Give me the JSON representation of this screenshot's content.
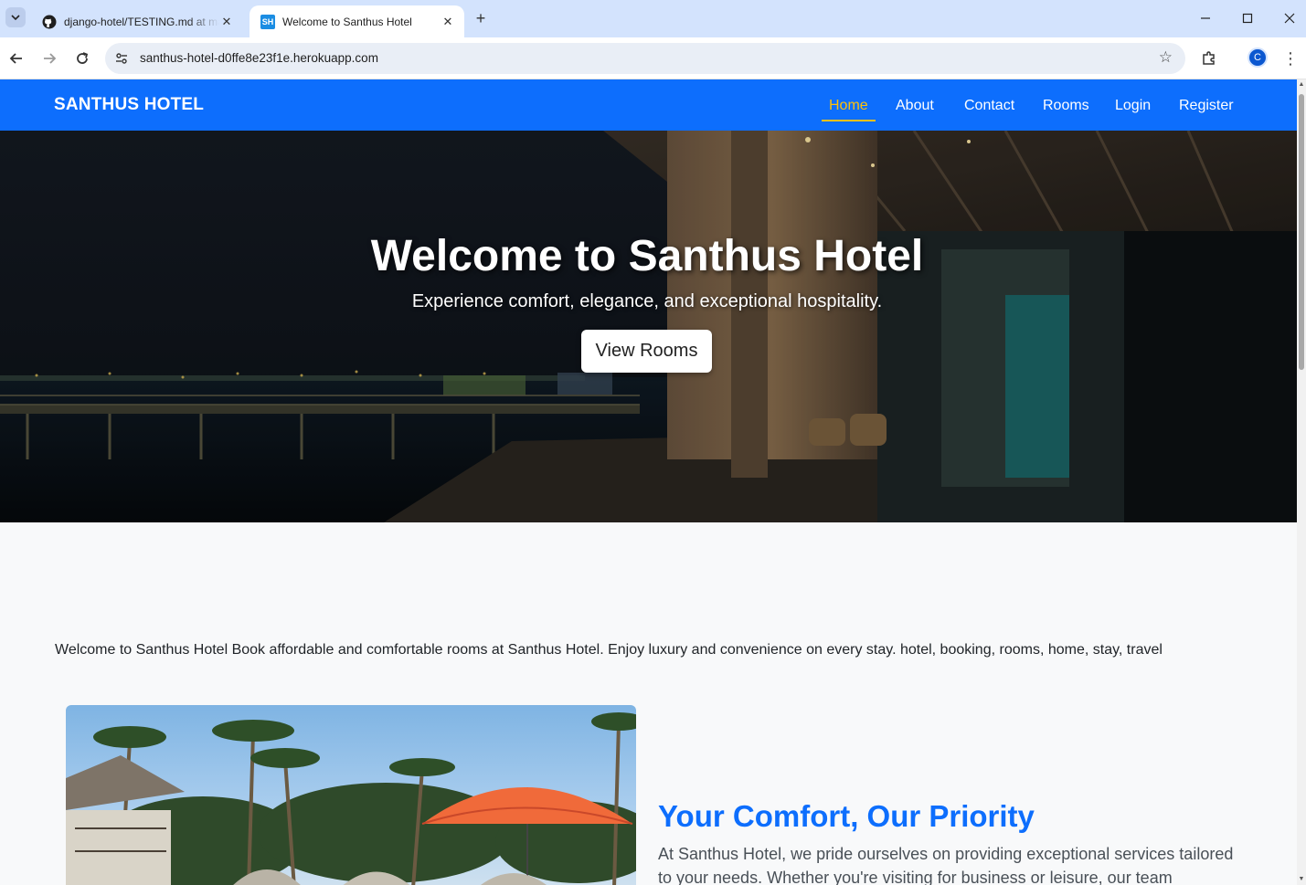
{
  "browser": {
    "tabs": [
      {
        "title": "django-hotel/TESTING.md at main",
        "active": false,
        "icon": "github-icon"
      },
      {
        "title": "Welcome to Santhus Hotel",
        "active": true,
        "icon": "SH"
      }
    ],
    "url": "santhus-hotel-d0ffe8e23f1e.herokuapp.com",
    "profile_initial": "C"
  },
  "navbar": {
    "brand": "SANTHUS HOTEL",
    "links": [
      "Home",
      "About",
      "Contact",
      "Rooms",
      "Login",
      "Register"
    ],
    "active_link": "Home"
  },
  "hero": {
    "title": "Welcome to Santhus Hotel",
    "subtitle": "Experience comfort, elegance, and exceptional hospitality.",
    "button": "View Rooms"
  },
  "intro": {
    "text": "Welcome to Santhus Hotel Book affordable and comfortable rooms at Santhus Hotel. Enjoy luxury and convenience on every stay. hotel, booking, rooms, home, stay, travel"
  },
  "feature": {
    "title": "Your Comfort, Our Priority",
    "text": "At Santhus Hotel, we pride ourselves on providing exceptional services tailored to your needs. Whether you're visiting for business or leisure, our team ensures"
  },
  "colors": {
    "navbar": "#0d6efd",
    "active_link": "#ffc107",
    "heading": "#0d6efd",
    "tabbar": "#d3e3fd"
  }
}
